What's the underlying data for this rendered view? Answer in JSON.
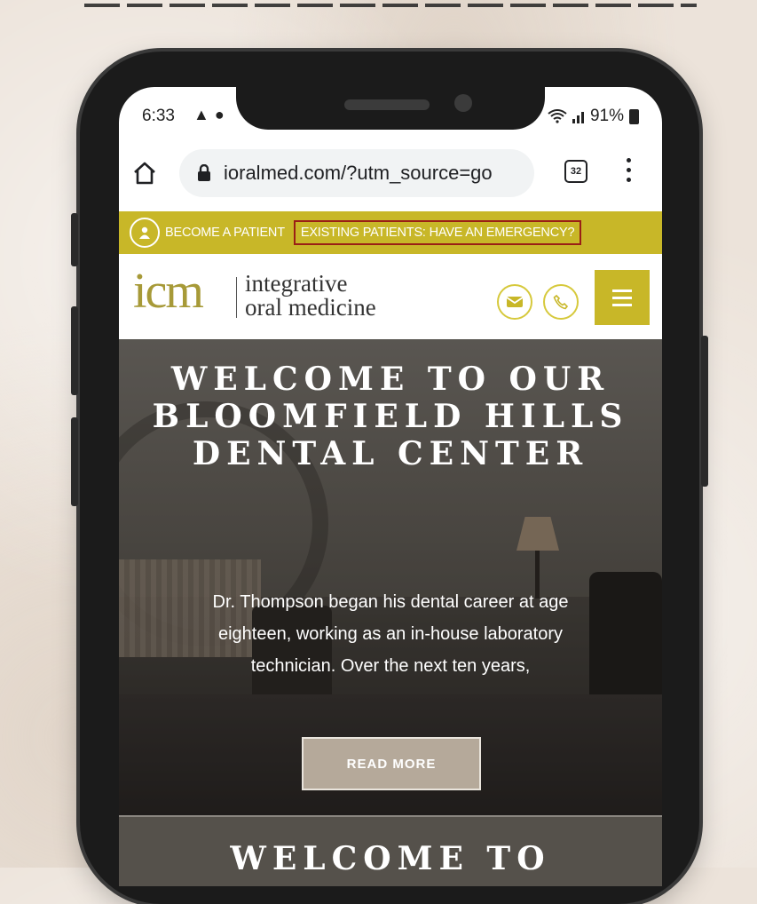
{
  "status_bar": {
    "time": "6:33",
    "battery": "91%"
  },
  "browser": {
    "url": "ioralmed.com/?utm_source=go",
    "tab_count": "32"
  },
  "promo_bar": {
    "become_patient": "BECOME A PATIENT",
    "emergency": "EXISTING PATIENTS: HAVE AN EMERGENCY?"
  },
  "header": {
    "logo_mark": "icm",
    "logo_line1": "integrative",
    "logo_line2": "oral medicine"
  },
  "hero": {
    "title": "WELCOME TO OUR BLOOMFIELD HILLS DENTAL CENTER",
    "body": "Dr. Thompson began his dental career at age eighteen, working as an in-house laboratory technician. Over the next ten years,",
    "button_label": "READ MORE"
  },
  "hero2": {
    "title": "WELCOME TO"
  },
  "colors": {
    "brand_gold": "#c8b728",
    "emergency_border": "#9a1f16",
    "button_fill": "#b5a99a"
  }
}
